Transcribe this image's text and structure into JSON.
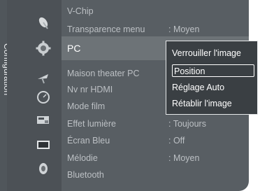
{
  "sidebar": {
    "title": "Configuration",
    "icons": [
      "satellite-dish-icon",
      "gear-icon",
      "antenna-icon",
      "gauge-icon",
      "monitor-icon",
      "display-icon",
      "speaker-icon"
    ]
  },
  "menu": {
    "items": [
      {
        "label": "V-Chip",
        "value": ""
      },
      {
        "label": "Transparence menu",
        "value": ": Moyen"
      },
      {
        "label": "PC",
        "value": ""
      },
      {
        "label": "Maison theater PC",
        "value": ":"
      },
      {
        "label": "Nv nr HDMI",
        "value": ":"
      },
      {
        "label": "Mode film",
        "value": ":"
      },
      {
        "label": "Effet lumière",
        "value": ": Toujours"
      },
      {
        "label": "Écran Bleu",
        "value": ": Off"
      },
      {
        "label": "Mélodie",
        "value": ": Moyen"
      },
      {
        "label": "Bluetooth",
        "value": ""
      }
    ]
  },
  "popup": {
    "options": [
      "Verrouiller l'image",
      "Position",
      "Réglage Auto",
      "Rétablir l'image"
    ],
    "selected": "Position"
  },
  "colors": {
    "panel": "#585e63",
    "highlight": "#6d7377",
    "popup_bg": "#3a3f43"
  }
}
